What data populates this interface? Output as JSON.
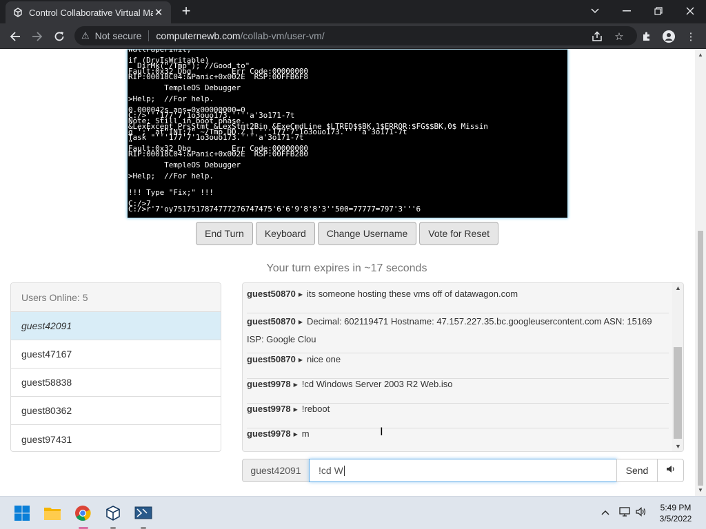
{
  "browser": {
    "tab_title": "Control Collaborative Virtual Mac",
    "new_tab": "+",
    "security_label": "Not secure",
    "url_host": "computernewb.com",
    "url_path": "/collab-vm/user-vm/",
    "window_controls": [
      "chevron-down-icon",
      "minimize-icon",
      "restore-icon",
      "close-icon"
    ]
  },
  "vm": {
    "screen_lines": [
      "WallPaperInit;",
      "",
      "if (DrvIsWritable)",
      "  DirMk(\"/Tmp\"); //Good to\"",
      "Fault:0x32 Dbg         Err Code:00000000",
      "RIP:00018C04:&Panic+0x002E  RSP:00FFB6F8",
      "",
      "        TempleOS Debugger",
      "",
      ">Help;  //For help.",
      "",
      "0.000042s ans=0x00000000=0",
      "C:/>'''177'7'1o3ouo173.''''a'3o171-7t",
      "Note: Still in boot phase.",
      "&LexExcept PrsStmt &LexStmt2Bin &ExeCmdLine $LTRED$$BK,1$ERROR:$FG$$BK,0$ Missin",
      "g ';' at\"INT:7\" ~/Tmp.DD.Z 1 '''177'7'1o3ouo173.''''a'3o171-7t",
      "Task \"'''177'7'1o3ouo173.''''a'3o171-7t",
      "\"",
      "Fault:0x32 Dbg         Err Code:00000000",
      "RIP:00018C04:&Panic+0x002E  RSP:00FFB280",
      "",
      "        TempleOS Debugger",
      "",
      ">Help;  //For help.",
      "",
      "",
      "!!! Type \"Fix;\" !!!",
      "",
      "C:/>7",
      "C:/>r'7'oy7517517874777276747475'6'6'9'8'8'3''500=77777=797'3'''6"
    ]
  },
  "controls": {
    "end_turn": "End Turn",
    "keyboard": "Keyboard",
    "change_username": "Change Username",
    "vote_reset": "Vote for Reset"
  },
  "turn_status": "Your turn expires in ~17 seconds",
  "users": {
    "header": "Users Online: 5",
    "list": [
      "guest42091",
      "guest47167",
      "guest58838",
      "guest80362",
      "guest97431"
    ]
  },
  "chat": {
    "messages": [
      {
        "user": "guest50870",
        "text": "its someone hosting these vms off of datawagon.com"
      },
      {
        "user": "guest50870",
        "text": "Decimal: 602119471 Hostname: 47.157.227.35.bc.googleusercontent.com ASN: 15169 ISP: Google Clou"
      },
      {
        "user": "guest50870",
        "text": "nice one"
      },
      {
        "user": "guest9978",
        "text": "!cd Windows Server 2003 R2 Web.iso"
      },
      {
        "user": "guest9978",
        "text": "!reboot"
      },
      {
        "user": "guest9978",
        "text": "m"
      }
    ],
    "input_username": "guest42091",
    "input_value": "!cd W",
    "send_label": "Send"
  },
  "taskbar": {
    "time": "5:49 PM",
    "date": "3/5/2022"
  }
}
